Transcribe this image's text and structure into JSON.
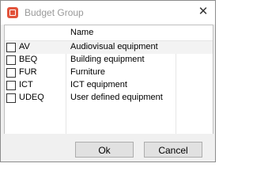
{
  "window": {
    "title": "Budget Group",
    "close_glyph": "✕"
  },
  "table": {
    "header": {
      "code": "",
      "name": "Name"
    },
    "rows": [
      {
        "checked": false,
        "code": "AV",
        "name": "Audiovisual equipment"
      },
      {
        "checked": false,
        "code": "BEQ",
        "name": "Building equipment"
      },
      {
        "checked": false,
        "code": "FUR",
        "name": "Furniture"
      },
      {
        "checked": false,
        "code": "ICT",
        "name": "ICT equipment"
      },
      {
        "checked": false,
        "code": "UDEQ",
        "name": "User defined equipment"
      }
    ]
  },
  "buttons": {
    "ok": "Ok",
    "cancel": "Cancel"
  },
  "colors": {
    "icon": "#e2533b",
    "title_text": "#999999",
    "selected_row": "#f3f3f3"
  }
}
